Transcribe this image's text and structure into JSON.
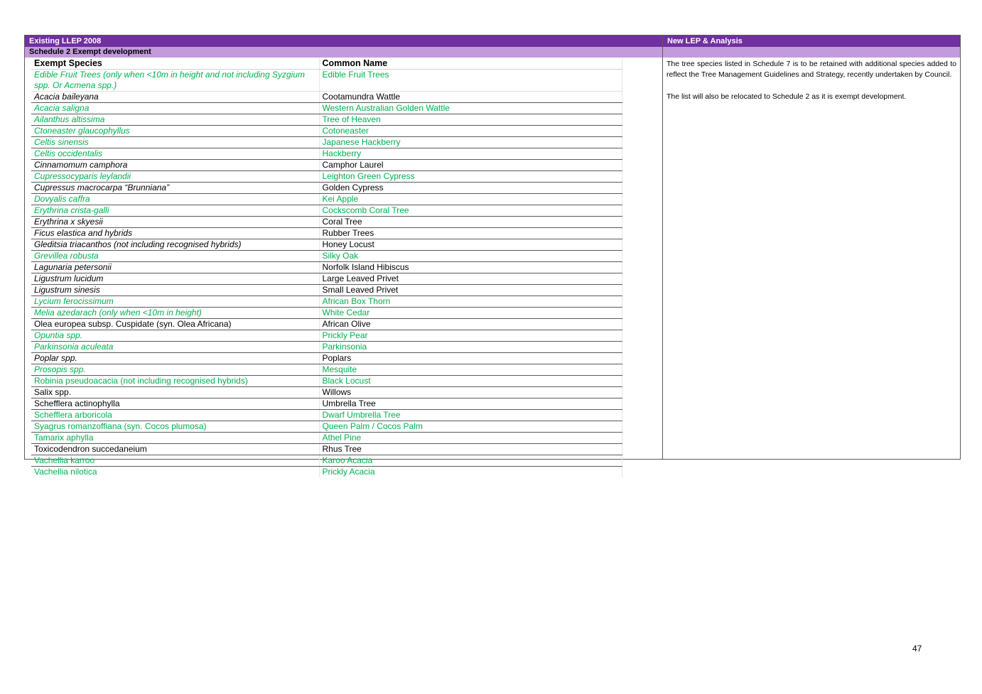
{
  "colors": {
    "header_purple": "#7030a0",
    "subheader_lavender": "#c39bdc",
    "highlight_green": "#00b050",
    "text_black": "#000000"
  },
  "header": {
    "left": "Existing LLEP 2008",
    "right": "New LEP & Analysis"
  },
  "subheader": {
    "left": "Schedule 2 Exempt development"
  },
  "table": {
    "columns": [
      "Exempt Species",
      "Common Name"
    ],
    "rows": [
      {
        "species": "Edible Fruit Trees (only when <10m in height and not including Syzgium spp. Or Acmena spp.)",
        "common": "Edible Fruit Trees",
        "color": "green",
        "italic": true
      },
      {
        "species": "Acacia baileyana",
        "common": "Cootamundra Wattle",
        "color": "black",
        "italic": true
      },
      {
        "species": "Acacia saligna",
        "common": "Western Australian Golden Wattle",
        "color": "green",
        "italic": true
      },
      {
        "species": "Ailanthus altissima",
        "common": "Tree of Heaven",
        "color": "green",
        "italic": true
      },
      {
        "species": "Ctoneaster glaucophyllus",
        "common": "Cotoneaster",
        "color": "green",
        "italic": true
      },
      {
        "species": "Celtis sinensis",
        "common": "Japanese Hackberry",
        "color": "green",
        "italic": true
      },
      {
        "species": "Celtis occidentalis",
        "common": "Hackberry",
        "color": "green",
        "italic": true
      },
      {
        "species": "Cinnamomum camphora",
        "common": "Camphor Laurel",
        "color": "black",
        "italic": true
      },
      {
        "species": "Cupressocyparis leylandii",
        "common": "Leighton Green Cypress",
        "color": "green",
        "italic": true
      },
      {
        "species": "Cupressus macrocarpa “Brunniana”",
        "common": "Golden Cypress",
        "color": "black",
        "italic": true
      },
      {
        "species": "Dovyalis caffra",
        "common": "Kei Apple",
        "color": "green",
        "italic": true
      },
      {
        "species": "Erythrina crista-galli",
        "common": "Cockscomb Coral Tree",
        "color": "green",
        "italic": true
      },
      {
        "species": "Erythrina x skyesii",
        "common": "Coral Tree",
        "color": "black",
        "italic": true
      },
      {
        "species": "Ficus elastica and hybrids",
        "common": "Rubber Trees",
        "color": "black",
        "italic": true
      },
      {
        "species": "Gleditsia triacanthos (not including recognised hybrids)",
        "common": "Honey Locust",
        "color": "black",
        "italic": true
      },
      {
        "species": "Grevillea robusta",
        "common": "Silky Oak",
        "color": "green",
        "italic": true
      },
      {
        "species": "Lagunaria petersonii",
        "common": "Norfolk Island Hibiscus",
        "color": "black",
        "italic": true
      },
      {
        "species": "Ligustrum lucidum",
        "common": "Large Leaved Privet",
        "color": "black",
        "italic": true
      },
      {
        "species": "Ligustrum sinesis",
        "common": "Small Leaved Privet",
        "color": "black",
        "italic": true
      },
      {
        "species": "Lycium ferocissimum",
        "common": "African Box Thorn",
        "color": "green",
        "italic": true
      },
      {
        "species": "Melia azedarach (only when <10m in height)",
        "common": "White Cedar",
        "color": "green",
        "italic": true
      },
      {
        "species": "Olea europea subsp. Cuspidate (syn. Olea Africana)",
        "common": "African Olive",
        "color": "black",
        "italic": false
      },
      {
        "species": "Opuntia spp.",
        "common": "Prickly Pear",
        "color": "green",
        "italic": true
      },
      {
        "species": "Parkinsonia aculeata",
        "common": "Parkinsonia",
        "color": "green",
        "italic": true
      },
      {
        "species": "Poplar spp.",
        "common": "Poplars",
        "color": "black",
        "italic": true
      },
      {
        "species": "Prosopis spp.",
        "common": "Mesquite",
        "color": "green",
        "italic": true
      },
      {
        "species": "Robinia pseudoacacia (not including recognised hybrids)",
        "common": "Black Locust",
        "color": "green",
        "italic": false
      },
      {
        "species": "Salix spp.",
        "common": "Willows",
        "color": "black",
        "italic": false
      },
      {
        "species": "Schefflera actinophylla",
        "common": "Umbrella Tree",
        "color": "black",
        "italic": false
      },
      {
        "species": "Schefflera arboricola",
        "common": "Dwarf Umbrella Tree",
        "color": "green",
        "italic": false
      },
      {
        "species": "Syagrus romanzoffiana (syn. Cocos plumosa)",
        "common": "Queen Palm / Cocos Palm",
        "color": "green",
        "italic": false
      },
      {
        "species": "Tamarix aphylla",
        "common": "Athel Pine",
        "color": "green",
        "italic": false
      },
      {
        "species": "Toxicodendron succedaneium",
        "common": "Rhus Tree",
        "color": "black",
        "italic": false
      },
      {
        "species": "Vachellia karroo",
        "common": "Karoo Acacia",
        "color": "green",
        "italic": false
      },
      {
        "species": "Vachellia nilotica",
        "common": "Prickly Acacia",
        "color": "green",
        "italic": false
      }
    ]
  },
  "analysis": {
    "paragraphs": [
      "The tree species listed in Schedule 7 is to be retained with additional species added to reflect the Tree Management Guidelines and Strategy, recently undertaken by Council.",
      "The list will also be relocated to Schedule 2 as it is exempt development."
    ]
  },
  "page_number": "47"
}
